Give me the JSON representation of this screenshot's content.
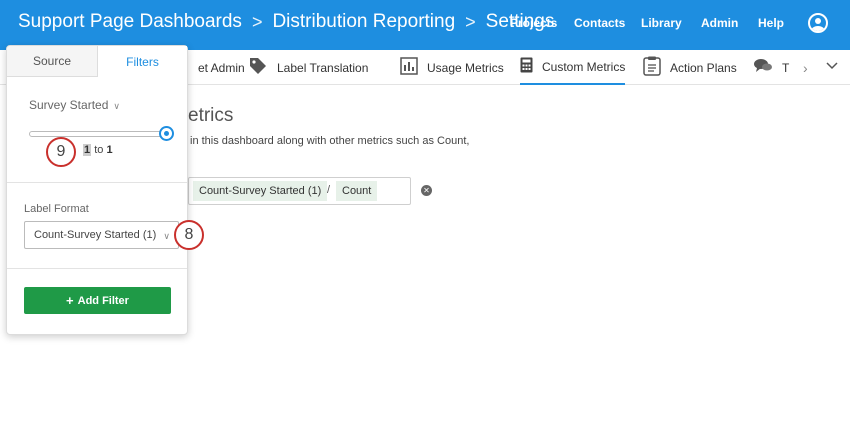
{
  "header": {
    "breadcrumb": [
      "Support Page Dashboards",
      "Distribution Reporting",
      "Settings"
    ],
    "separator": ">",
    "nav": [
      "Projects",
      "Contacts",
      "Library",
      "Admin",
      "Help"
    ]
  },
  "tabs": [
    {
      "label": "et Admin",
      "icon": "admin-icon"
    },
    {
      "label": "Label Translation",
      "icon": "tag-icon"
    },
    {
      "label": "Usage Metrics",
      "icon": "bar-chart-icon"
    },
    {
      "label": "Custom Metrics",
      "icon": "calculator-icon",
      "active": true
    },
    {
      "label": "Action Plans",
      "icon": "clipboard-icon"
    },
    {
      "label": "T",
      "icon": "speech-bubbles-icon"
    }
  ],
  "main": {
    "heading": "etrics",
    "description": "in this dashboard along with other metrics such as Count,",
    "formula": {
      "left": "Count-Survey Started (1)",
      "operator": "/",
      "right": "Count"
    }
  },
  "panel": {
    "tabs": {
      "source": "Source",
      "filters": "Filters"
    },
    "filter_label": "Survey Started",
    "range": {
      "from": "1",
      "to_word": "to",
      "to": "1",
      "value": 1
    },
    "label_format_title": "Label Format",
    "label_format_value": "Count-Survey Started (1)",
    "add_filter": "Add Filter"
  },
  "callouts": {
    "nine": "9",
    "eight": "8"
  },
  "colors": {
    "header": "#1e8ee0",
    "accent": "#1e8ee0",
    "button": "#1f9a47",
    "callout": "#c9302c"
  }
}
